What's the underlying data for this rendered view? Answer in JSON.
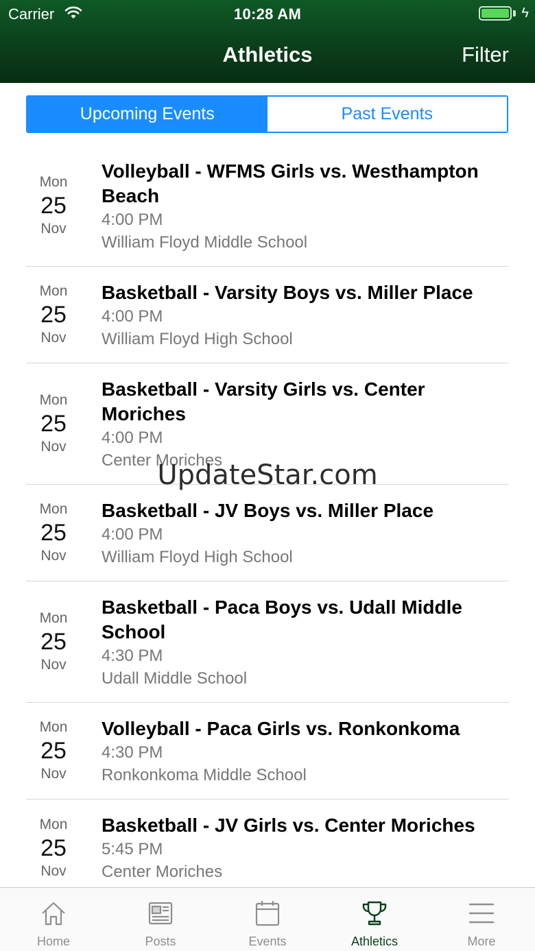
{
  "status_bar": {
    "carrier": "Carrier",
    "time": "10:28 AM"
  },
  "nav": {
    "title": "Athletics",
    "filter_label": "Filter"
  },
  "tabs": {
    "upcoming": "Upcoming Events",
    "past": "Past Events"
  },
  "events": [
    {
      "dow": "Mon",
      "day": "25",
      "month": "Nov",
      "title": "Volleyball - WFMS Girls vs. Westhampton Beach",
      "time": "4:00 PM",
      "location": "William Floyd Middle School"
    },
    {
      "dow": "Mon",
      "day": "25",
      "month": "Nov",
      "title": "Basketball - Varsity Boys vs. Miller Place",
      "time": "4:00 PM",
      "location": "William Floyd High School"
    },
    {
      "dow": "Mon",
      "day": "25",
      "month": "Nov",
      "title": "Basketball - Varsity Girls vs. Center Moriches",
      "time": "4:00 PM",
      "location": "Center Moriches"
    },
    {
      "dow": "Mon",
      "day": "25",
      "month": "Nov",
      "title": "Basketball - JV Boys vs. Miller Place",
      "time": "4:00 PM",
      "location": "William Floyd High School"
    },
    {
      "dow": "Mon",
      "day": "25",
      "month": "Nov",
      "title": "Basketball - Paca Boys vs. Udall Middle School",
      "time": "4:30 PM",
      "location": "Udall Middle School"
    },
    {
      "dow": "Mon",
      "day": "25",
      "month": "Nov",
      "title": "Volleyball - Paca Girls vs. Ronkonkoma",
      "time": "4:30 PM",
      "location": "Ronkonkoma Middle School"
    },
    {
      "dow": "Mon",
      "day": "25",
      "month": "Nov",
      "title": "Basketball - JV Girls vs. Center Moriches",
      "time": "5:45 PM",
      "location": "Center Moriches"
    }
  ],
  "watermark": "UpdateStar.com",
  "tabbar": {
    "items": [
      {
        "label": "Home",
        "icon": "home-icon"
      },
      {
        "label": "Posts",
        "icon": "newspaper-icon"
      },
      {
        "label": "Events",
        "icon": "calendar-icon"
      },
      {
        "label": "Athletics",
        "icon": "trophy-icon"
      },
      {
        "label": "More",
        "icon": "menu-icon"
      }
    ],
    "active_color": "#0b3f1b",
    "inactive_color": "#8e8e8e"
  },
  "colors": {
    "header": "#0b3f1b",
    "accent": "#1a8cff"
  }
}
